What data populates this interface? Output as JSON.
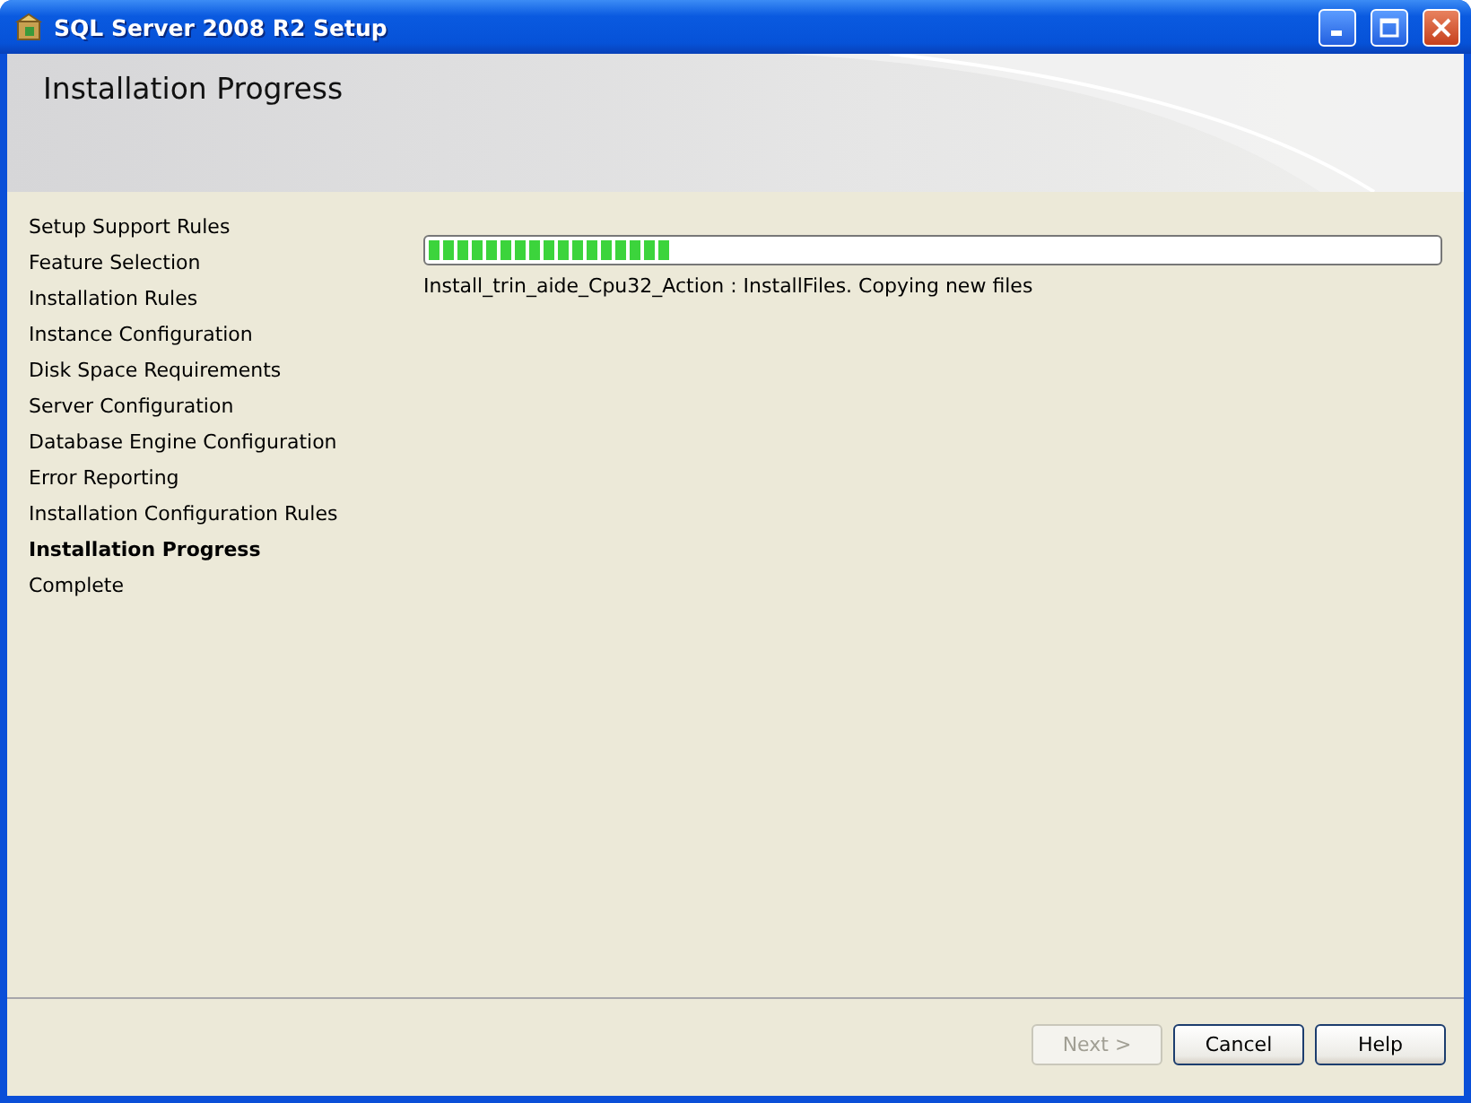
{
  "window": {
    "title": "SQL Server 2008 R2 Setup"
  },
  "header": {
    "title": "Installation Progress"
  },
  "steps": [
    {
      "label": "Setup Support Rules",
      "selected": false
    },
    {
      "label": "Feature Selection",
      "selected": false
    },
    {
      "label": "Installation Rules",
      "selected": false
    },
    {
      "label": "Instance Configuration",
      "selected": false
    },
    {
      "label": "Disk Space Requirements",
      "selected": false
    },
    {
      "label": "Server Configuration",
      "selected": false
    },
    {
      "label": "Database Engine Configuration",
      "selected": false
    },
    {
      "label": "Error Reporting",
      "selected": false
    },
    {
      "label": "Installation Configuration Rules",
      "selected": false
    },
    {
      "label": "Installation Progress",
      "selected": true
    },
    {
      "label": "Complete",
      "selected": false
    }
  ],
  "progress": {
    "level": 0.24,
    "status": "Install_trin_aide_Cpu32_Action : InstallFiles. Copying new files"
  },
  "buttons": [
    {
      "label": "Next >",
      "disabled": true
    },
    {
      "label": "Cancel",
      "disabled": false
    },
    {
      "label": "Help",
      "disabled": false
    }
  ]
}
